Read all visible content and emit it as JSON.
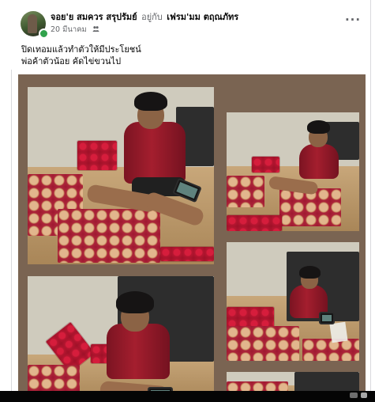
{
  "post": {
    "author_name": "จอย'ย สมควร สรุปรัมย์",
    "with_text": "อยู่กับ",
    "tagged_name": "เฟรม'มม ตฤณภัทร",
    "timestamp": "20 มีนาคม",
    "caption_line_1": "ปิดเทอมแล้วทำตัวให้มีประโยชน์",
    "caption_line_2": "พ่อค้าตัวน้อย  คัดไข่ขวนไป",
    "more_label": "···",
    "privacy_icon": "friends-icon"
  },
  "colors": {
    "online": "#31a24c",
    "gallery_background": "#7a6452",
    "tray_red": "#c51b35",
    "shirt_red": "#9f1b2c"
  },
  "gallery": {
    "photos": [
      "boy sorting eggs close-up",
      "boy seated among egg trays",
      "boy kneeling near cabinet",
      "boy holding empty tray",
      "boy working on floor"
    ]
  }
}
